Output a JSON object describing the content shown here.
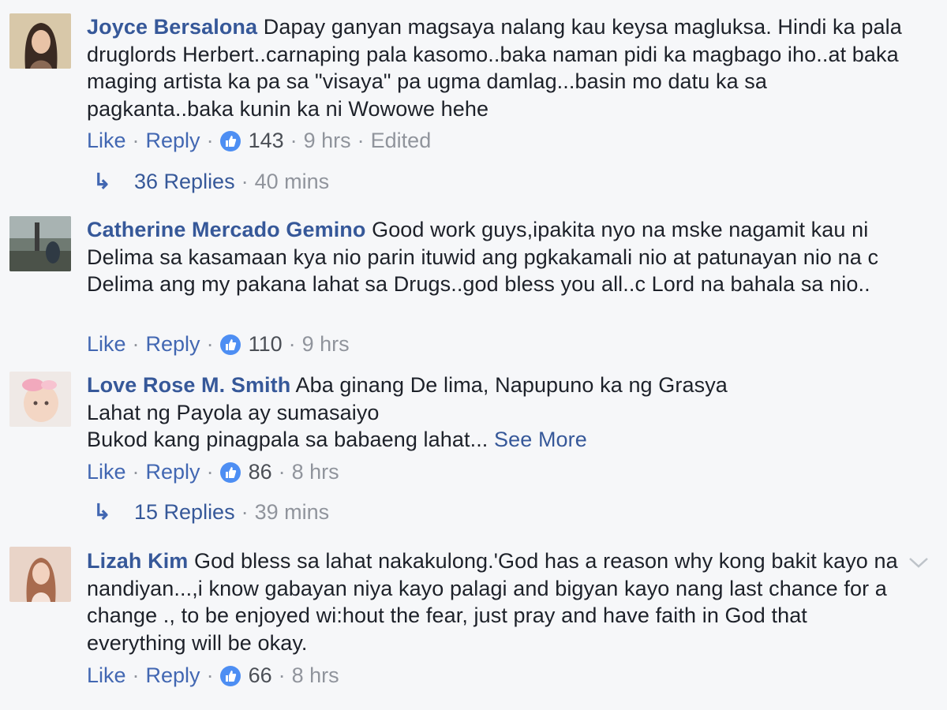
{
  "ui": {
    "like_label": "Like",
    "reply_label": "Reply",
    "separator": "·",
    "see_more": "See More",
    "colors": {
      "author": "#365899",
      "link": "#4267b2",
      "meta": "#90949c",
      "badge": "#4d8ef3"
    }
  },
  "comments": [
    {
      "author": "Joyce Bersalona",
      "text": "Dapay ganyan magsaya nalang kau keysa magluksa. Hindi ka pala druglords Herbert..carnaping pala kasomo..baka naman pidi ka magbago iho..at baka maging artista ka pa sa \"visaya\" pa ugma damlag...basin mo datu ka sa pagkanta..baka kunin ka ni Wowowe hehe",
      "reactions": "143",
      "time": "9 hrs",
      "edited": "Edited",
      "replies_label": "36 Replies",
      "replies_time": "40 mins"
    },
    {
      "author": "Catherine Mercado Gemino",
      "text": "Good work guys,ipakita nyo na mske nagamit kau ni Delima sa kasamaan kya nio parin ituwid ang pgkakamali nio at patunayan nio na c Delima ang my pakana lahat sa Drugs..god bless you all..c Lord na bahala sa nio..",
      "reactions": "110",
      "time": "9 hrs"
    },
    {
      "author": "Love Rose M. Smith",
      "text_lines": [
        "Aba ginang De lima, Napupuno ka ng Grasya",
        "Lahat ng Payola ay sumasaiyo",
        "Bukod kang pinagpala sa babaeng lahat..."
      ],
      "reactions": "86",
      "time": "8 hrs",
      "replies_label": "15 Replies",
      "replies_time": "39 mins"
    },
    {
      "author": "Lizah Kim",
      "text": "God bless sa lahat nakakulong.'God has a reason why kong bakit kayo na nandiyan...,i know gabayan niya kayo palagi and bigyan kayo nang last chance for a change ., to be enjoyed wi:hout the fear, just pray and have faith in God that everything will be okay.",
      "reactions": "66",
      "time": "8 hrs"
    }
  ]
}
